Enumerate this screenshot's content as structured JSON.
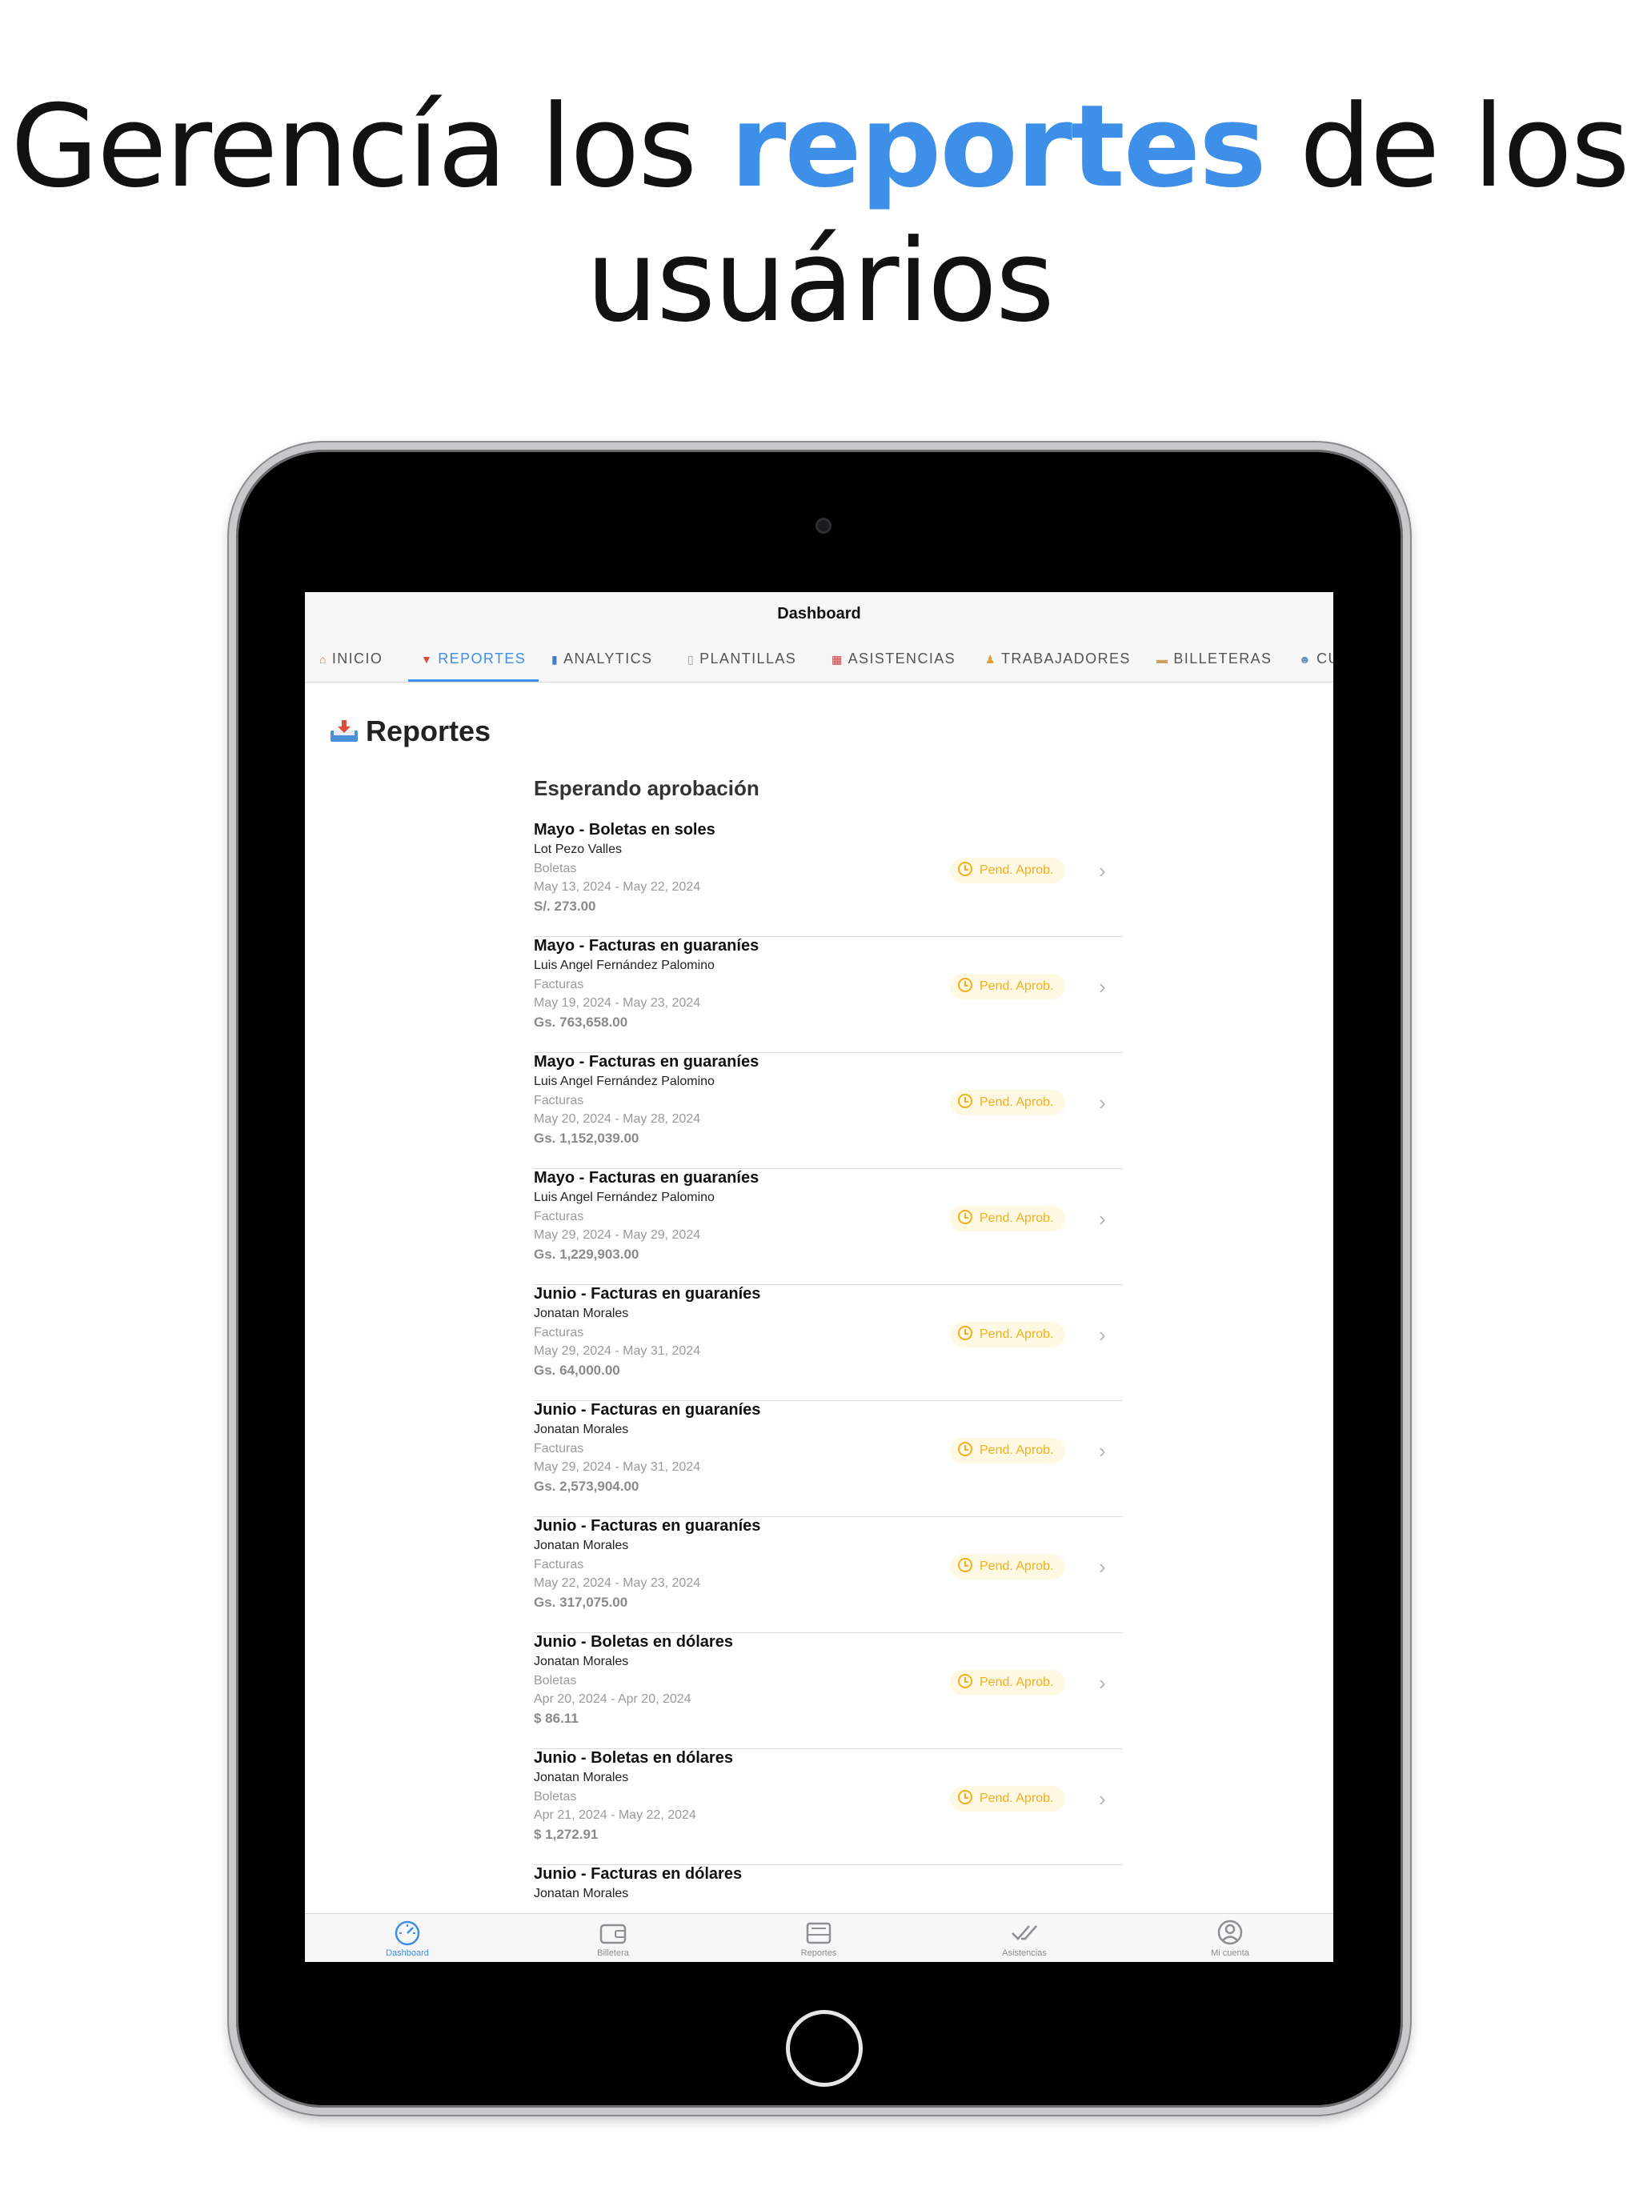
{
  "headline": {
    "before": "Gerencía los ",
    "accent": "reportes",
    "after": " de los usuários"
  },
  "app": {
    "nav_title": "Dashboard",
    "tabs": [
      {
        "icon": "house-icon",
        "label": "INICIO"
      },
      {
        "icon": "inbox-icon",
        "label": "REPORTES"
      },
      {
        "icon": "bar-chart-icon",
        "label": "ANALYTICS"
      },
      {
        "icon": "page-icon",
        "label": "PLANTILLAS"
      },
      {
        "icon": "calendar-icon",
        "label": "ASISTENCIAS"
      },
      {
        "icon": "worker-icon",
        "label": "TRABAJADORES"
      },
      {
        "icon": "wallet-icon",
        "label": "BILLETERAS"
      },
      {
        "icon": "people-icon",
        "label": "CU"
      }
    ],
    "active_tab": "REPORTES",
    "page_title": "Reportes",
    "section_title": "Esperando aprobación",
    "reports": [
      {
        "title": "Mayo - Boletas en soles",
        "user": "Lot Pezo Valles",
        "type": "Boletas",
        "dates": "May 13, 2024 - May 22, 2024",
        "amount": "S/. 273.00",
        "status": "Pend. Aprob."
      },
      {
        "title": "Mayo - Facturas en guaraníes",
        "user": "Luis Angel Fernández Palomino",
        "type": "Facturas",
        "dates": "May 19, 2024 - May 23, 2024",
        "amount": "Gs. 763,658.00",
        "status": "Pend. Aprob."
      },
      {
        "title": "Mayo - Facturas en guaraníes",
        "user": "Luis Angel Fernández Palomino",
        "type": "Facturas",
        "dates": "May 20, 2024 - May 28, 2024",
        "amount": "Gs. 1,152,039.00",
        "status": "Pend. Aprob."
      },
      {
        "title": "Mayo - Facturas en guaraníes",
        "user": "Luis Angel Fernández Palomino",
        "type": "Facturas",
        "dates": "May 29, 2024 - May 29, 2024",
        "amount": "Gs. 1,229,903.00",
        "status": "Pend. Aprob."
      },
      {
        "title": "Junio - Facturas en guaraníes",
        "user": "Jonatan Morales",
        "type": "Facturas",
        "dates": "May 29, 2024 - May 31, 2024",
        "amount": "Gs. 64,000.00",
        "status": "Pend. Aprob."
      },
      {
        "title": "Junio - Facturas en guaraníes",
        "user": "Jonatan Morales",
        "type": "Facturas",
        "dates": "May 29, 2024 - May 31, 2024",
        "amount": "Gs. 2,573,904.00",
        "status": "Pend. Aprob."
      },
      {
        "title": "Junio - Facturas en guaraníes",
        "user": "Jonatan Morales",
        "type": "Facturas",
        "dates": "May 22, 2024 - May 23, 2024",
        "amount": "Gs. 317,075.00",
        "status": "Pend. Aprob."
      },
      {
        "title": "Junio - Boletas en dólares",
        "user": "Jonatan Morales",
        "type": "Boletas",
        "dates": "Apr 20, 2024 - Apr 20, 2024",
        "amount": "$ 86.11",
        "status": "Pend. Aprob."
      },
      {
        "title": "Junio - Boletas en dólares",
        "user": "Jonatan Morales",
        "type": "Boletas",
        "dates": "Apr 21, 2024 - May 22, 2024",
        "amount": "$ 1,272.91",
        "status": "Pend. Aprob."
      },
      {
        "title": "Junio - Facturas en dólares",
        "user": "Jonatan Morales",
        "type": "",
        "dates": "",
        "amount": "",
        "status": ""
      }
    ],
    "bottom_tabs": [
      {
        "icon": "speedometer-icon",
        "label": "Dashboard"
      },
      {
        "icon": "wallet-icon",
        "label": "Billetera"
      },
      {
        "icon": "tray-icon",
        "label": "Reportes"
      },
      {
        "icon": "checkmarks-icon",
        "label": "Asistencias"
      },
      {
        "icon": "person-circle-icon",
        "label": "Mi cuenta"
      }
    ],
    "active_bottom_tab": "Dashboard",
    "colors": {
      "accent": "#3d8fe8",
      "pending": "#f2b01e",
      "pending_bg": "#fff8e2"
    }
  }
}
